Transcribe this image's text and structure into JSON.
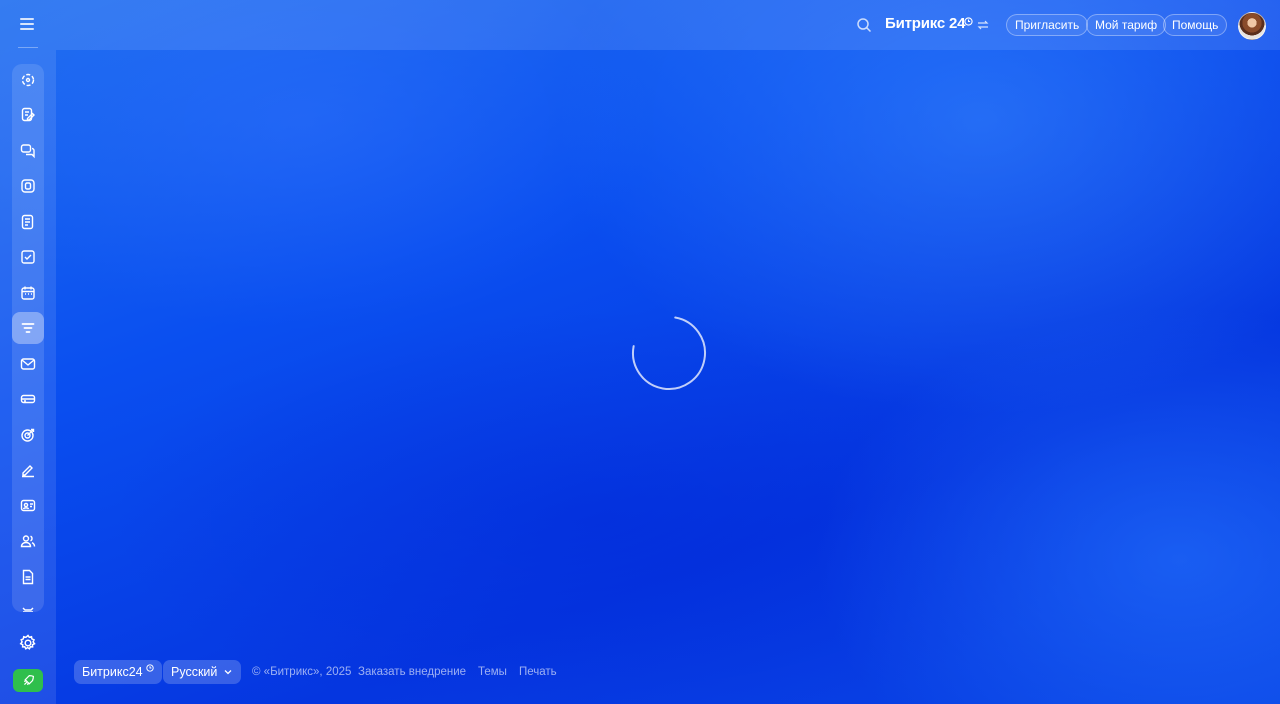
{
  "header": {
    "brand": "Битрикс 24",
    "buttons": {
      "invite": "Пригласить",
      "plan": "Мой тариф",
      "help": "Помощь"
    }
  },
  "sidebar": {
    "items": [
      {
        "icon": "activity-icon"
      },
      {
        "icon": "feed-edit-icon"
      },
      {
        "icon": "chat-icon"
      },
      {
        "icon": "video-call-icon"
      },
      {
        "icon": "documents-icon"
      },
      {
        "icon": "tasks-icon"
      },
      {
        "icon": "calendar-icon"
      },
      {
        "icon": "crm-funnel-icon",
        "active": true
      },
      {
        "icon": "mail-icon"
      },
      {
        "icon": "inventory-icon"
      },
      {
        "icon": "marketing-target-icon"
      },
      {
        "icon": "sign-icon"
      },
      {
        "icon": "contact-center-icon"
      },
      {
        "icon": "employees-icon"
      },
      {
        "icon": "file-icon"
      },
      {
        "icon": "bot-icon"
      }
    ]
  },
  "footer": {
    "brand_button": "Битрикс24",
    "language": "Русский",
    "copyright": "© «Битрикс», 2025",
    "order_impl": "Заказать внедрение",
    "themes": "Темы",
    "print": "Печать"
  },
  "colors": {
    "accent": "#0a4ff0",
    "rocket": "#2fbf4c"
  }
}
